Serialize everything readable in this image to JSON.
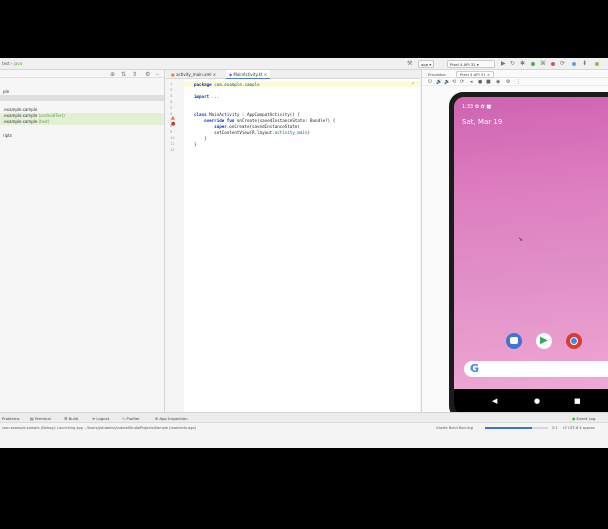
{
  "nav": {
    "breadcrumb_prefix": "test",
    "breadcrumb_pkg": "java",
    "device_selector": "app",
    "device_name": "Pixel 4 API 31"
  },
  "project": {
    "rows": [
      {
        "text": "ple",
        "muted": ""
      },
      {
        "text": ".example.sample",
        "muted": ""
      },
      {
        "text": ".example.sample",
        "muted": " (androidTest)"
      },
      {
        "text": ".example.sample",
        "muted": " (test)"
      },
      {
        "text": "ripts",
        "muted": ""
      }
    ]
  },
  "editor": {
    "tabs": [
      {
        "label": "activity_main.xml",
        "icon": "xml-file-icon"
      },
      {
        "label": "MainActivity.kt",
        "icon": "kotlin-file-icon"
      }
    ],
    "lines": [
      {
        "n": "1",
        "code": "package com.example.sample"
      },
      {
        "n": "2",
        "code": ""
      },
      {
        "n": "3",
        "code": "import ..."
      },
      {
        "n": "4",
        "code": ""
      },
      {
        "n": "5",
        "code": ""
      },
      {
        "n": "6",
        "code": "class MainActivity : AppCompatActivity() {"
      },
      {
        "n": "7",
        "code": "    override fun onCreate(savedInstanceState: Bundle?) {"
      },
      {
        "n": "8",
        "code": "        super.onCreate(savedInstanceState)"
      },
      {
        "n": "9",
        "code": "        setContentView(R.layout.activity_main)"
      },
      {
        "n": "10",
        "code": "    }"
      },
      {
        "n": "11",
        "code": "}"
      },
      {
        "n": "12",
        "code": ""
      }
    ]
  },
  "emulator": {
    "label": "Emulator:",
    "device_tab": "Pixel 4 API 31",
    "status_time": "1:33",
    "date": "Sat, Mar 19"
  },
  "toolstrip": {
    "items": [
      "Problems",
      "Terminal",
      "Build",
      "Logcat",
      "Profiler",
      "App Inspection"
    ],
    "event_log": "Event Log"
  },
  "statusbar": {
    "message": "com.example.sample (Debug): Launching app - /Users/jakubeks/AndroidStudioProjects/Sample (moments ago)",
    "right_label": "Gradle Build Running",
    "position": "5:1",
    "encoding": "LF  UTF-8  4 spaces",
    "progress": 0.75
  },
  "colors": {
    "accent": "#3d73c9",
    "wallpaper_top": "#cf63b1",
    "wallpaper_bottom": "#efb0d8"
  }
}
